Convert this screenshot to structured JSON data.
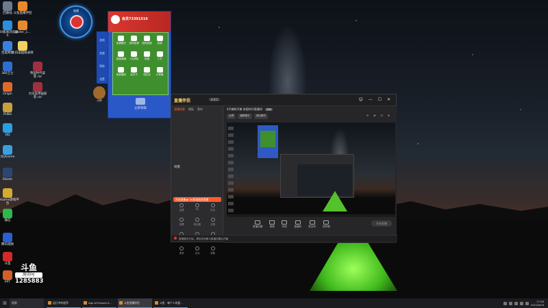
{
  "desktop_icons": [
    {
      "label": "回收站",
      "color": "#6b7a8c"
    },
    {
      "label": "斗鱼直播伴侣",
      "color": "#e8892b"
    },
    {
      "label": "360极速浏览器X",
      "color": "#2d8ee0"
    },
    {
      "label": "caster_1...",
      "color": "#e8892b"
    },
    {
      "label": "百度网盘",
      "color": "#3b7fe0"
    },
    {
      "label": "大白菜超级录屏",
      "color": "#f0d060"
    },
    {
      "label": "360卫士",
      "color": "#2d6fcf"
    },
    {
      "label": "帝国时代安装.rar",
      "color": "#a03040"
    },
    {
      "label": "Origin",
      "color": "#e06a2a"
    },
    {
      "label": "大白菜帝国安装.rar",
      "color": "#a03040"
    },
    {
      "label": "PUBG",
      "color": "#c8a040"
    },
    {
      "label": "QQ",
      "color": "#2a9ee0"
    },
    {
      "label": "QQGame",
      "color": "#3aa0e0"
    },
    {
      "label": "Steam",
      "color": "#2b4670"
    },
    {
      "label": "WeGame游戏平台",
      "color": "#d4aa30"
    },
    {
      "label": "微信",
      "color": "#2eb84a"
    },
    {
      "label": "腾讯视频",
      "color": "#2a60d0"
    },
    {
      "label": "斗鱼",
      "color": "#d02a2a"
    },
    {
      "label": "PPT",
      "color": "#d0602a"
    }
  ],
  "float_ball": {
    "title": "加速"
  },
  "side_strip": [
    "游戏",
    "加速",
    "帮助",
    "设置"
  ],
  "red_panel": {
    "user_id": "会员73391516",
    "grid": [
      "加速模式",
      "游戏加速",
      "游戏加速",
      "加速",
      "高速通道",
      "1元体验",
      "充值",
      "三方",
      "免费福利",
      "会员卡",
      "领红包",
      "大神道"
    ],
    "footer": "立即领取"
  },
  "mascot_label": "大神",
  "stream_window": {
    "logo": "直播伴侣",
    "badge": "4.9.1",
    "controls": "☺ — ☐ ✕",
    "tabs": [
      "直播场景",
      "模板",
      "素材"
    ],
    "scene_label": "场景",
    "live_bar": "开始直播",
    "orange_label": "开启直播 ▶ 4K高清画质直播",
    "tools": [
      "连麦",
      "PK",
      "红包",
      "投票",
      "粉丝团",
      "礼物",
      "弹幕",
      "主播任务",
      "设置",
      "更多",
      "互动",
      "录像"
    ],
    "room_title": "4不做和不做 帝国时代直播间",
    "room_tag": "房间",
    "toolbar": [
      "全屏",
      "横屏模式",
      "添加素材"
    ],
    "toolbar_icons": "⟳ ⚙ ☐ ⊕",
    "bottom_tools": [
      "直播设置",
      "美颜",
      "特效",
      "直播间",
      "麦克风",
      "扬声器"
    ],
    "go_live": "开始直播",
    "status": "直播暂未开始，请检查设备与直播设置后开播"
  },
  "watermark": {
    "logo": "斗鱼",
    "sub": "房间号",
    "room_no": "1285883"
  },
  "taskbar": {
    "start_icon": "⊞",
    "search": "搜索",
    "items": [
      "运行中的程序",
      "Age of Empire II...",
      "斗鱼直播伴侣",
      "斗鱼 · 每个人的直..."
    ],
    "active_index": 2,
    "clock_time": "17:58",
    "clock_date": "2022/6/26"
  }
}
